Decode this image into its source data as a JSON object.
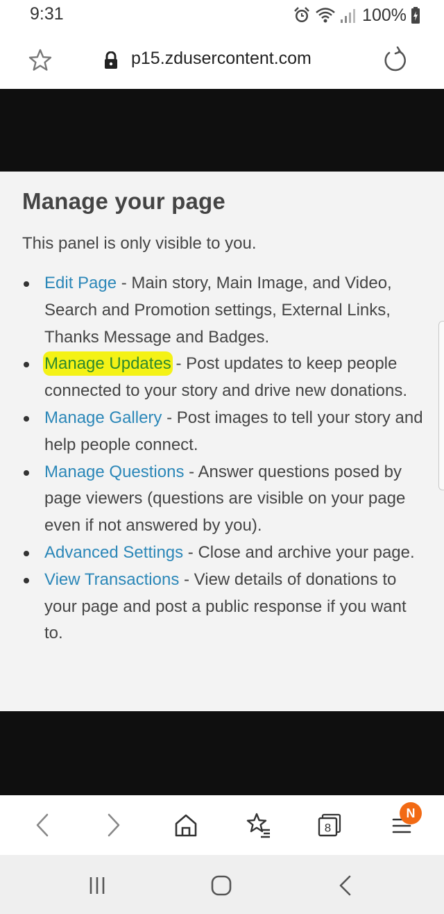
{
  "status_bar": {
    "time": "9:31",
    "battery": "100%"
  },
  "browser": {
    "url": "p15.zdusercontent.com"
  },
  "panel": {
    "title": "Manage your page",
    "description": "This panel is only visible to you.",
    "items": [
      {
        "link": "Edit Page",
        "text": " - Main story, Main Image, and Video, Search and Promotion settings, External Links, Thanks Message and Badges."
      },
      {
        "link": "Manage Updates",
        "text": " - Post updates to keep people connected to your story and drive new donations."
      },
      {
        "link": "Manage Gallery",
        "text": " - Post images to tell your story and help people connect."
      },
      {
        "link": "Manage Questions",
        "text": " - Answer questions posed by page viewers (questions are visible on your page even if not answered by you)."
      },
      {
        "link": "Advanced Settings",
        "text": " - Close and archive your page."
      },
      {
        "link": "View Transactions",
        "text": " - View details of donations to your page and post a public response if you want to."
      }
    ]
  },
  "toolbar": {
    "tabs_count": "8",
    "notification_badge": "N"
  },
  "colors": {
    "link": "#2b87b8",
    "highlight": "#f4f216",
    "badge": "#f26a14"
  }
}
